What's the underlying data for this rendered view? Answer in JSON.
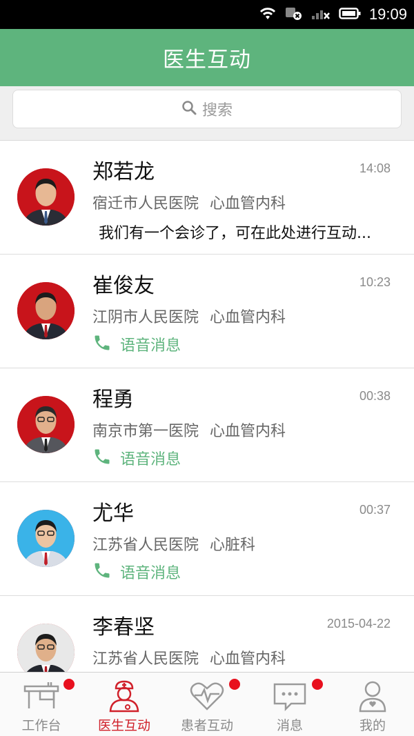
{
  "status_bar": {
    "time": "19:09",
    "icons": [
      "wifi-icon",
      "notification-mute-icon",
      "signal-icon",
      "battery-icon"
    ]
  },
  "header": {
    "title": "医生互动"
  },
  "search": {
    "placeholder": "搜索"
  },
  "conversations": [
    {
      "name": "郑若龙",
      "time": "14:08",
      "hospital": "宿迁市人民医院",
      "department": "心血管内科",
      "message": "我们有一个会诊了，可在此处进行互动...",
      "type": "text",
      "avatar_bg": "#c8141b"
    },
    {
      "name": "崔俊友",
      "time": "10:23",
      "hospital": "江阴市人民医院",
      "department": "心血管内科",
      "message": "语音消息",
      "type": "voice",
      "avatar_bg": "#c8141b"
    },
    {
      "name": "程勇",
      "time": "00:38",
      "hospital": "南京市第一医院",
      "department": "心血管内科",
      "message": "语音消息",
      "type": "voice",
      "avatar_bg": "#c8141b"
    },
    {
      "name": "尤华",
      "time": "00:37",
      "hospital": "江苏省人民医院",
      "department": "心脏科",
      "message": "语音消息",
      "type": "voice",
      "avatar_bg": "#3ab3e8"
    },
    {
      "name": "李春坚",
      "time": "2015-04-22",
      "hospital": "江苏省人民医院",
      "department": "心血管内科",
      "message": "",
      "type": "text",
      "avatar_bg": "#e8e8e8"
    }
  ],
  "tabs": [
    {
      "label": "工作台",
      "icon": "workbench-icon",
      "active": false,
      "badge": true
    },
    {
      "label": "医生互动",
      "icon": "doctor-icon",
      "active": true,
      "badge": false
    },
    {
      "label": "患者互动",
      "icon": "heartbeat-icon",
      "active": false,
      "badge": true
    },
    {
      "label": "消息",
      "icon": "message-icon",
      "active": false,
      "badge": true
    },
    {
      "label": "我的",
      "icon": "profile-icon",
      "active": false,
      "badge": false
    }
  ],
  "colors": {
    "brand_green": "#5eb47d",
    "active_red": "#d0202a",
    "badge_red": "#e8101e"
  }
}
